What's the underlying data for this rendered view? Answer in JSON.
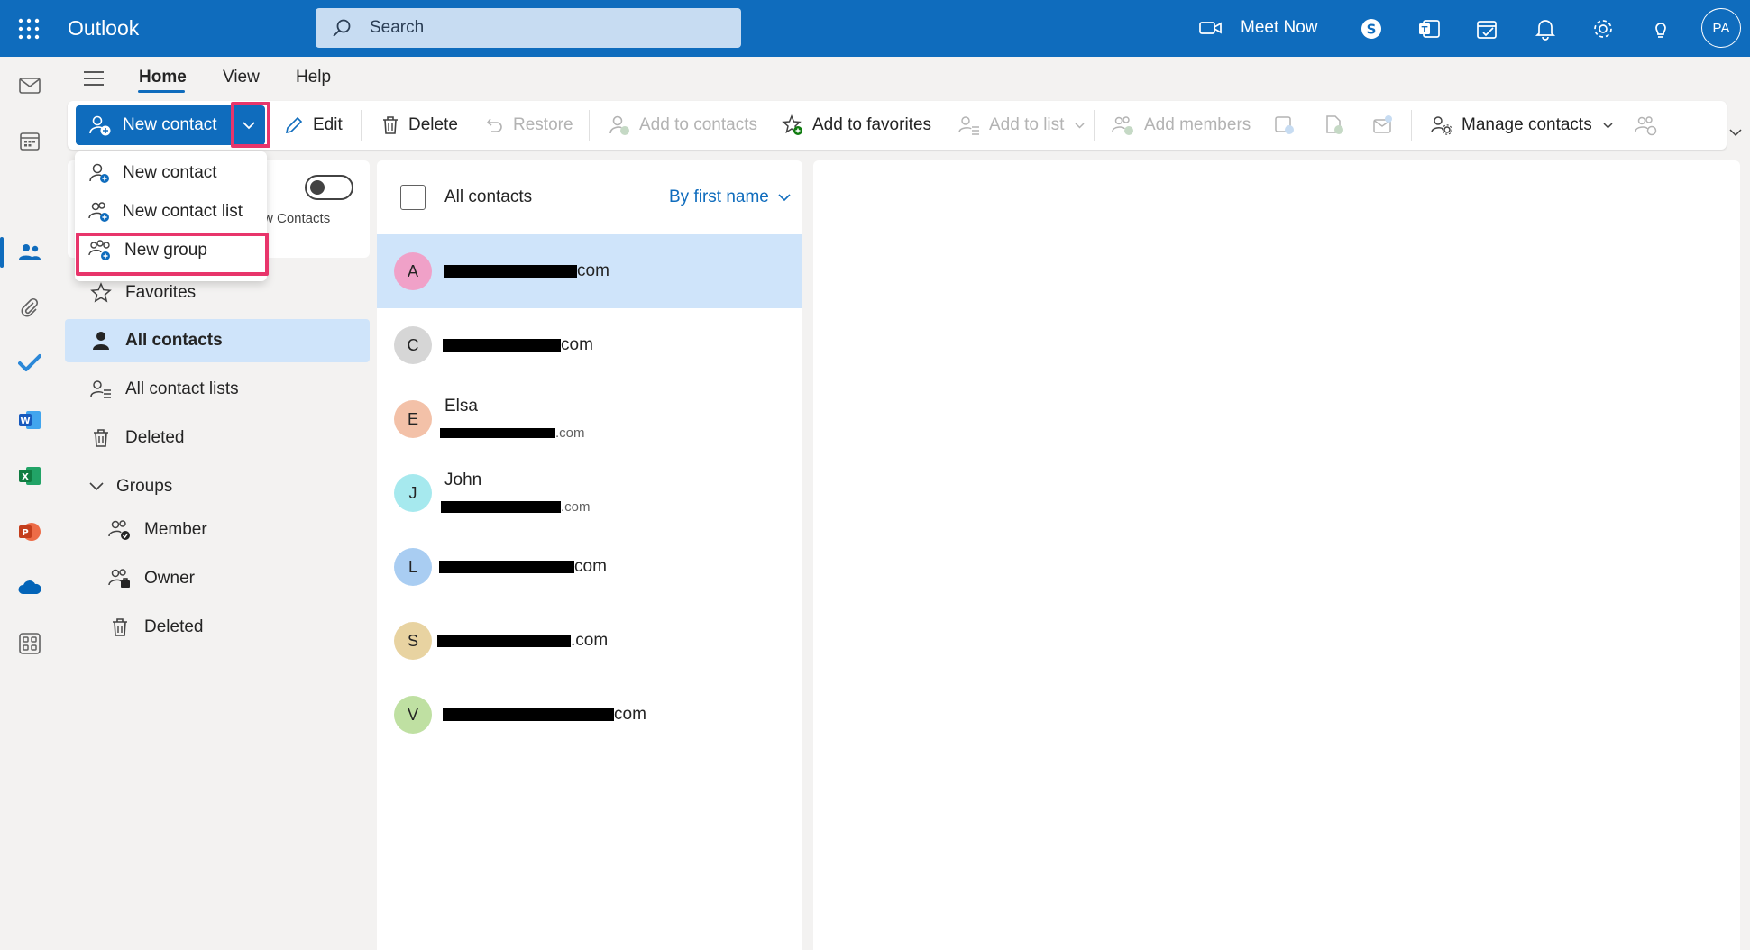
{
  "topbar": {
    "app_name": "Outlook",
    "search_placeholder": "Search",
    "meet_now_label": "Meet Now",
    "avatar_initials": "PA",
    "icons": [
      "waffle-icon",
      "skype-icon",
      "teams-icon",
      "my-day-icon",
      "bell-icon",
      "gear-icon",
      "lightbulb-icon"
    ]
  },
  "rail": {
    "apps": [
      "mail",
      "calendar",
      "people",
      "files",
      "to-do",
      "word",
      "excel",
      "powerpoint",
      "onedrive",
      "more-apps"
    ],
    "selected": "people"
  },
  "tabs": [
    {
      "label": "Home",
      "active": true
    },
    {
      "label": "View",
      "active": false
    },
    {
      "label": "Help",
      "active": false
    }
  ],
  "ribbon": {
    "new_contact": "New contact",
    "edit": "Edit",
    "delete": "Delete",
    "restore": "Restore",
    "add_to_contacts": "Add to contacts",
    "add_to_favorites": "Add to favorites",
    "add_to_list": "Add to list",
    "add_members": "Add members",
    "manage_contacts": "Manage contacts"
  },
  "new_menu": {
    "items": [
      "New contact",
      "New contact list",
      "New group"
    ],
    "highlighted": "New group"
  },
  "folder_pane": {
    "toggle_label": "w Contacts",
    "favorites": "Favorites",
    "all_contacts": "All contacts",
    "all_contact_lists": "All contact lists",
    "deleted": "Deleted",
    "groups": "Groups",
    "member": "Member",
    "owner": "Owner",
    "groups_deleted": "Deleted"
  },
  "contact_list": {
    "header": "All contacts",
    "sort_label": "By first name",
    "contacts": [
      {
        "initial": "A",
        "name": "",
        "email_suffix": "com",
        "color": "#f0a1c8",
        "selected": true
      },
      {
        "initial": "C",
        "name": "",
        "email_suffix": "com",
        "color": "#d6d6d6",
        "selected": false
      },
      {
        "initial": "E",
        "name": "Elsa",
        "email_suffix": ".com",
        "color": "#f3c1a8",
        "selected": false
      },
      {
        "initial": "J",
        "name": "John",
        "email_suffix": ".com",
        "color": "#a6e9ee",
        "selected": false
      },
      {
        "initial": "L",
        "name": "",
        "email_suffix": "com",
        "color": "#a9cdf2",
        "selected": false
      },
      {
        "initial": "S",
        "name": "",
        "email_suffix": ".com",
        "color": "#e8d3a1",
        "selected": false
      },
      {
        "initial": "V",
        "name": "",
        "email_suffix": "com",
        "color": "#bfe0a2",
        "selected": false
      }
    ]
  }
}
